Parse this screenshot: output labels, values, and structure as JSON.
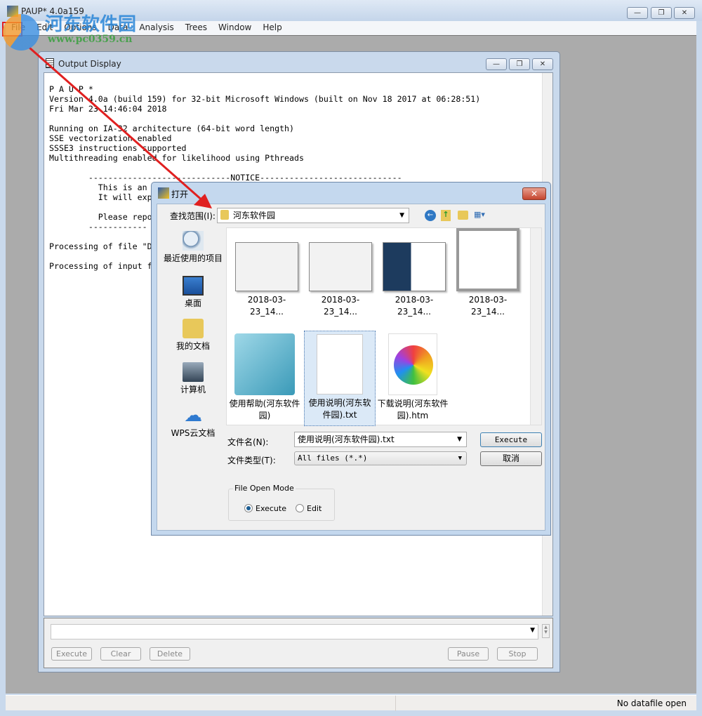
{
  "app": {
    "title": "PAUP* 4.0a159",
    "menu": [
      "File",
      "Edit",
      "Options",
      "Data",
      "Analysis",
      "Trees",
      "Window",
      "Help"
    ],
    "window_controls": [
      "minimize",
      "restore",
      "close"
    ]
  },
  "watermark": {
    "text": "河东软件园",
    "url": "www.pc0359.cn"
  },
  "output_window": {
    "title": "Output Display",
    "lines": [
      "P A U P *",
      "Version 4.0a (build 159) for 32-bit Microsoft Windows (built on Nov 18 2017 at 06:28:51)",
      "Fri Mar 23 14:46:04 2018",
      "",
      "Running on IA-32 architecture (64-bit word length)",
      "SSE vectorization enabled",
      "SSSE3 instructions supported",
      "Multithreading enabled for likelihood using Pthreads",
      "",
      "        -----------------------------NOTICE-----------------------------",
      "          This is an",
      "          It will exp",
      "",
      "          Please repo",
      "        ------------",
      "",
      "Processing of file \"D",
      "",
      "Processing of input f"
    ],
    "command_input": "",
    "buttons": {
      "execute": "Execute",
      "clear": "Clear",
      "delete": "Delete",
      "pause": "Pause",
      "stop": "Stop"
    }
  },
  "dialog": {
    "title": "打开",
    "look_in_label": "查找范围(I):",
    "look_in_value": "河东软件园",
    "places": [
      "最近使用的项目",
      "桌面",
      "我的文档",
      "计算机",
      "WPS云文档"
    ],
    "files": [
      {
        "name": "2018-03-23_14...",
        "type": "image"
      },
      {
        "name": "2018-03-23_14...",
        "type": "image"
      },
      {
        "name": "2018-03-23_14...",
        "type": "image"
      },
      {
        "name": "2018-03-23_14...",
        "type": "image"
      },
      {
        "name": "使用帮助(河东软件园)",
        "type": "shortcut"
      },
      {
        "name": "使用说明(河东软件园).txt",
        "type": "text",
        "selected": true
      },
      {
        "name": "下载说明(河东软件园).htm",
        "type": "html"
      }
    ],
    "filename_label": "文件名(N):",
    "filename_value": "使用说明(河东软件园).txt",
    "filetype_label": "文件类型(T):",
    "filetype_value": "All files (*.*)",
    "execute_button": "Execute",
    "cancel_button": "取消",
    "open_mode": {
      "label": "File Open Mode",
      "options": [
        "Execute",
        "Edit"
      ],
      "selected": "Execute"
    }
  },
  "status": {
    "right": "No datafile open"
  },
  "colors": {
    "annotation": "#e02020",
    "mdi_background": "#ababab",
    "radio_selected": "#1b5d93"
  }
}
